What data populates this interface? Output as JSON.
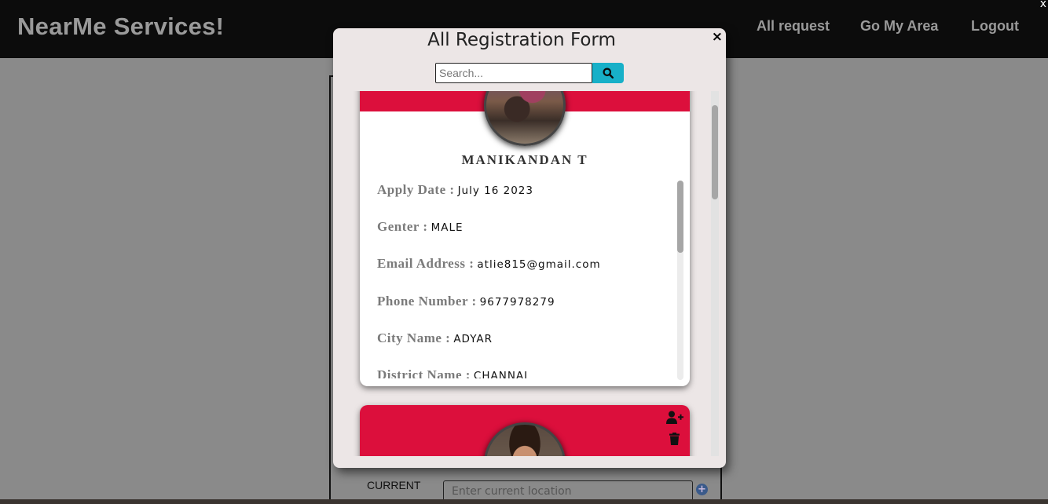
{
  "navbar": {
    "brand": "NearMe Services!",
    "links": [
      "All request",
      "Go My Area",
      "Logout"
    ],
    "close_glyph": "x"
  },
  "background_form": {
    "label": "CURRENT",
    "input_placeholder": "Enter current location"
  },
  "modal": {
    "title": "All Registration Form",
    "close_glyph": "×",
    "search_placeholder": "Search...",
    "search_icon": "search-icon"
  },
  "cards": [
    {
      "name": "MANIKANDAN T",
      "header_color": "#dc0f3c",
      "details": [
        {
          "label": "Apply Date :",
          "value": "July 16 2023"
        },
        {
          "label": "Genter :",
          "value": "MALE"
        },
        {
          "label": "Email Address :",
          "value": "atlie815@gmail.com"
        },
        {
          "label": "Phone Number :",
          "value": "9677978279"
        },
        {
          "label": "City Name :",
          "value": "ADYAR"
        },
        {
          "label": "District Name :",
          "value": "CHANNAI"
        }
      ]
    },
    {
      "actions": [
        "add-user-icon",
        "trash-icon"
      ]
    }
  ],
  "colors": {
    "navbar_bg": "#0c0c0c",
    "accent_red": "#dc0f3c",
    "search_button": "#17b0c8",
    "overlay_bg": "#8a8a8a"
  }
}
